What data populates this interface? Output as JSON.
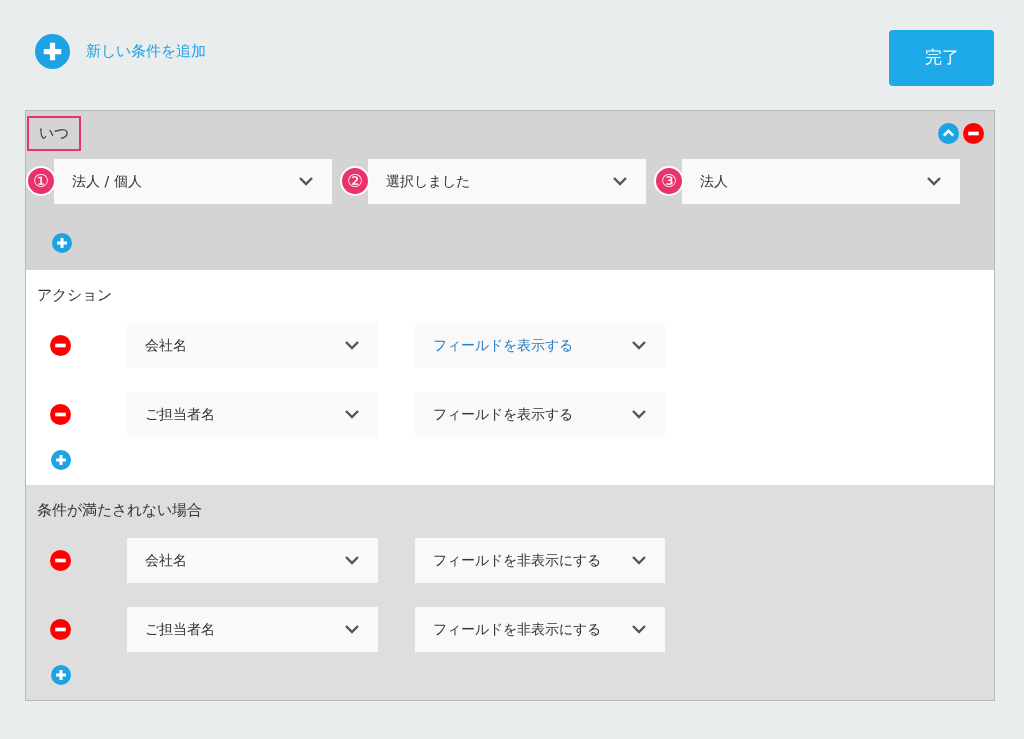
{
  "add_condition": {
    "label": "新しい条件を追加"
  },
  "done_button": {
    "label": "完了"
  },
  "when": {
    "title": "いつ",
    "highlighted": true,
    "selects": [
      {
        "marker": "①",
        "value": "法人 / 個人"
      },
      {
        "marker": "②",
        "value": "選択しました"
      },
      {
        "marker": "③",
        "value": "法人"
      }
    ]
  },
  "sections": [
    {
      "title": "アクション",
      "kind": "action",
      "rows": [
        {
          "field": "会社名",
          "action": "フィールドを表示する",
          "active": true
        },
        {
          "field": "ご担当者名",
          "action": "フィールドを表示する",
          "active": false
        }
      ]
    },
    {
      "title": "条件が満たされない場合",
      "kind": "else",
      "rows": [
        {
          "field": "会社名",
          "action": "フィールドを非表示にする",
          "active": false
        },
        {
          "field": "ご担当者名",
          "action": "フィールドを非表示にする",
          "active": false
        }
      ]
    }
  ]
}
